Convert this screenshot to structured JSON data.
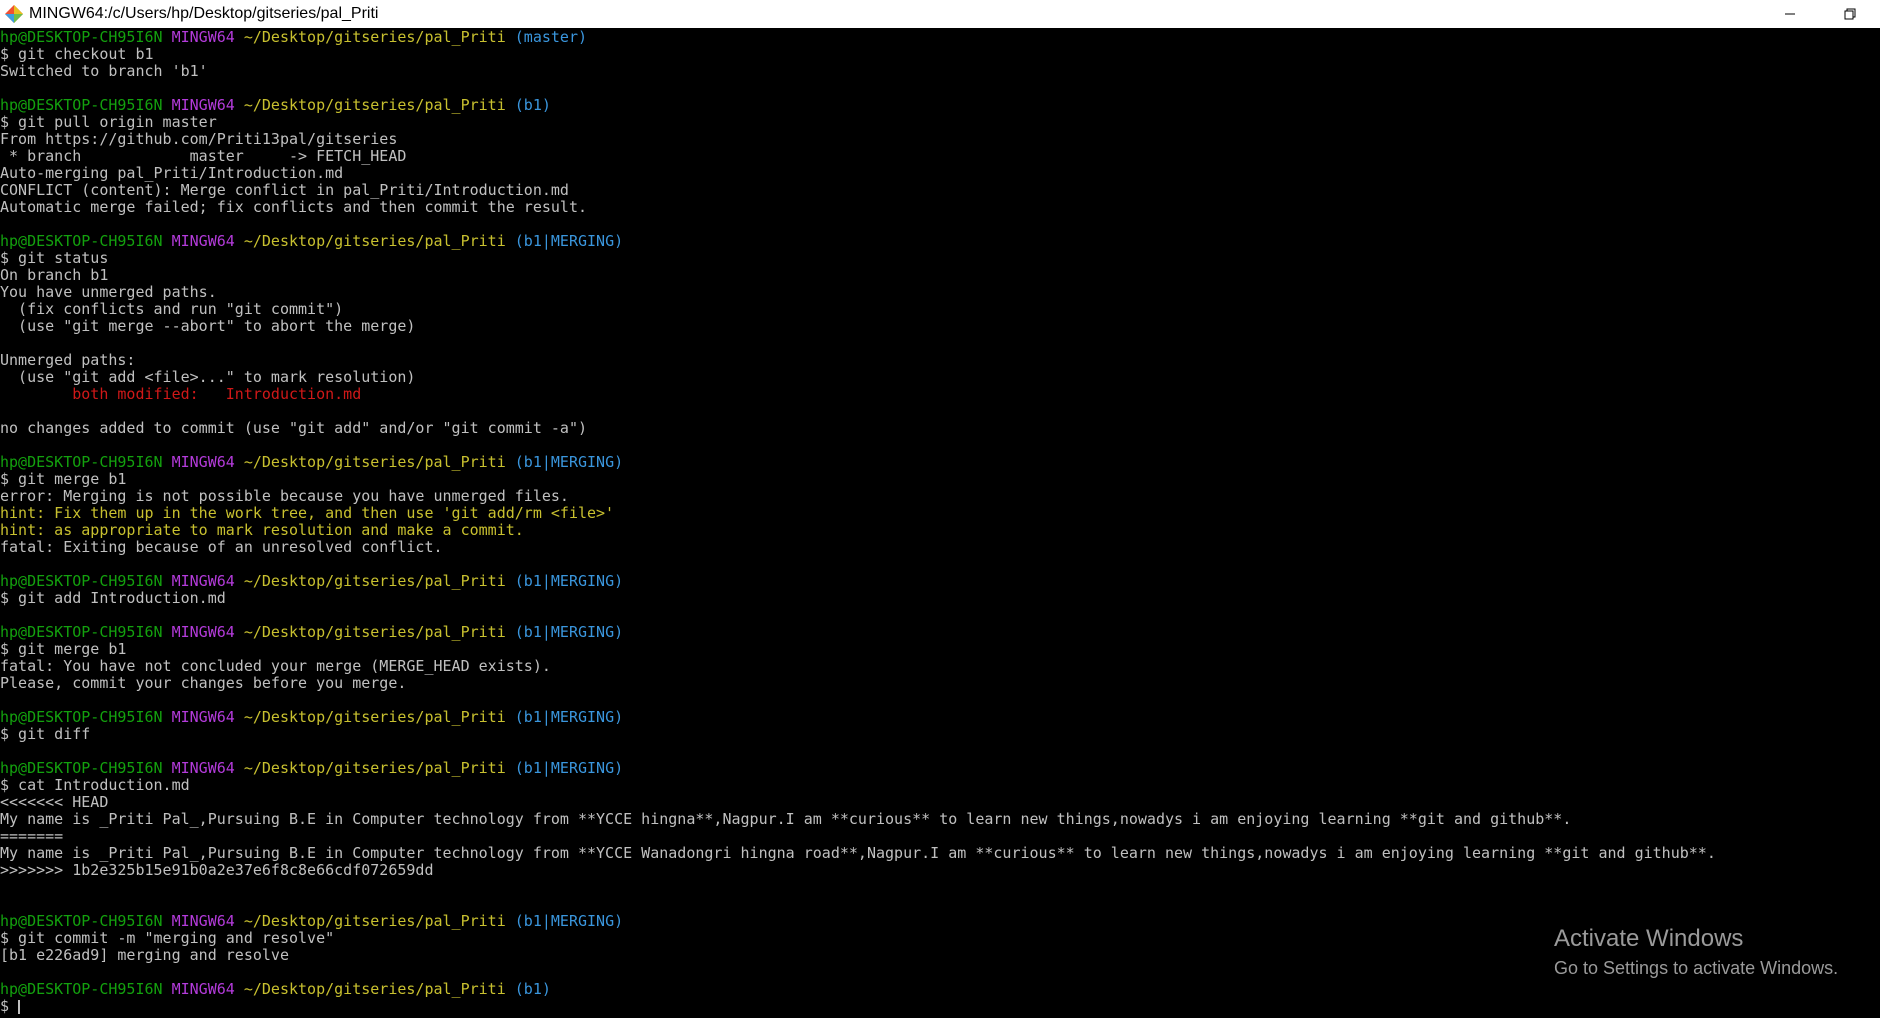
{
  "window": {
    "title": "MINGW64:/c/Users/hp/Desktop/gitseries/pal_Priti",
    "icons": [
      "git-bash-icon",
      "minimize-icon",
      "restore-icon"
    ]
  },
  "colors": {
    "background": "#000000",
    "text": "#c0c0c0",
    "user_host": "#13a10e",
    "mingw": "#b43bdb",
    "path": "#c8c02f",
    "branch": "#3a96dd",
    "error": "#d01818"
  },
  "terminal": {
    "lines": [
      {
        "type": "prompt",
        "user": "hp@DESKTOP-CH95I6N",
        "env": "MINGW64",
        "path": "~/Desktop/gitseries/pal_Priti",
        "branch": "(master)"
      },
      {
        "type": "cmd",
        "text": "$ git checkout b1"
      },
      {
        "type": "out",
        "text": "Switched to branch 'b1'"
      },
      {
        "type": "blank",
        "text": ""
      },
      {
        "type": "prompt",
        "user": "hp@DESKTOP-CH95I6N",
        "env": "MINGW64",
        "path": "~/Desktop/gitseries/pal_Priti",
        "branch": "(b1)"
      },
      {
        "type": "cmd",
        "text": "$ git pull origin master"
      },
      {
        "type": "out",
        "text": "From https://github.com/Priti13pal/gitseries"
      },
      {
        "type": "out",
        "text": " * branch            master     -> FETCH_HEAD"
      },
      {
        "type": "out",
        "text": "Auto-merging pal_Priti/Introduction.md"
      },
      {
        "type": "out",
        "text": "CONFLICT (content): Merge conflict in pal_Priti/Introduction.md"
      },
      {
        "type": "out",
        "text": "Automatic merge failed; fix conflicts and then commit the result."
      },
      {
        "type": "blank",
        "text": ""
      },
      {
        "type": "prompt",
        "user": "hp@DESKTOP-CH95I6N",
        "env": "MINGW64",
        "path": "~/Desktop/gitseries/pal_Priti",
        "branch": "(b1|MERGING)"
      },
      {
        "type": "cmd",
        "text": "$ git status"
      },
      {
        "type": "out",
        "text": "On branch b1"
      },
      {
        "type": "out",
        "text": "You have unmerged paths."
      },
      {
        "type": "out",
        "text": "  (fix conflicts and run \"git commit\")"
      },
      {
        "type": "out",
        "text": "  (use \"git merge --abort\" to abort the merge)"
      },
      {
        "type": "blank",
        "text": ""
      },
      {
        "type": "out",
        "text": "Unmerged paths:"
      },
      {
        "type": "out",
        "text": "  (use \"git add <file>...\" to mark resolution)"
      },
      {
        "type": "error",
        "text": "        both modified:   Introduction.md"
      },
      {
        "type": "blank",
        "text": ""
      },
      {
        "type": "out",
        "text": "no changes added to commit (use \"git add\" and/or \"git commit -a\")"
      },
      {
        "type": "blank",
        "text": ""
      },
      {
        "type": "prompt",
        "user": "hp@DESKTOP-CH95I6N",
        "env": "MINGW64",
        "path": "~/Desktop/gitseries/pal_Priti",
        "branch": "(b1|MERGING)"
      },
      {
        "type": "cmd",
        "text": "$ git merge b1"
      },
      {
        "type": "out",
        "text": "error: Merging is not possible because you have unmerged files."
      },
      {
        "type": "hint",
        "text": "hint: Fix them up in the work tree, and then use 'git add/rm <file>'"
      },
      {
        "type": "hint",
        "text": "hint: as appropriate to mark resolution and make a commit."
      },
      {
        "type": "out",
        "text": "fatal: Exiting because of an unresolved conflict."
      },
      {
        "type": "blank",
        "text": ""
      },
      {
        "type": "prompt",
        "user": "hp@DESKTOP-CH95I6N",
        "env": "MINGW64",
        "path": "~/Desktop/gitseries/pal_Priti",
        "branch": "(b1|MERGING)"
      },
      {
        "type": "cmd",
        "text": "$ git add Introduction.md"
      },
      {
        "type": "blank",
        "text": ""
      },
      {
        "type": "prompt",
        "user": "hp@DESKTOP-CH95I6N",
        "env": "MINGW64",
        "path": "~/Desktop/gitseries/pal_Priti",
        "branch": "(b1|MERGING)"
      },
      {
        "type": "cmd",
        "text": "$ git merge b1"
      },
      {
        "type": "out",
        "text": "fatal: You have not concluded your merge (MERGE_HEAD exists)."
      },
      {
        "type": "out",
        "text": "Please, commit your changes before you merge."
      },
      {
        "type": "blank",
        "text": ""
      },
      {
        "type": "prompt",
        "user": "hp@DESKTOP-CH95I6N",
        "env": "MINGW64",
        "path": "~/Desktop/gitseries/pal_Priti",
        "branch": "(b1|MERGING)"
      },
      {
        "type": "cmd",
        "text": "$ git diff"
      },
      {
        "type": "blank",
        "text": ""
      },
      {
        "type": "prompt",
        "user": "hp@DESKTOP-CH95I6N",
        "env": "MINGW64",
        "path": "~/Desktop/gitseries/pal_Priti",
        "branch": "(b1|MERGING)"
      },
      {
        "type": "cmd",
        "text": "$ cat Introduction.md"
      },
      {
        "type": "out",
        "text": "<<<<<<< HEAD"
      },
      {
        "type": "out",
        "text": "My name is _Priti Pal_,Pursuing B.E in Computer technology from **YCCE hingna**,Nagpur.I am **curious** to learn new things,nowadys i am enjoying learning **git and github**."
      },
      {
        "type": "out",
        "text": "======="
      },
      {
        "type": "out",
        "text": "My name is _Priti Pal_,Pursuing B.E in Computer technology from **YCCE Wanadongri hingna road**,Nagpur.I am **curious** to learn new things,nowadys i am enjoying learning **git and github**."
      },
      {
        "type": "out",
        "text": ">>>>>>> 1b2e325b15e91b0a2e37e6f8c8e66cdf072659dd"
      },
      {
        "type": "blank",
        "text": ""
      },
      {
        "type": "blank",
        "text": ""
      },
      {
        "type": "prompt",
        "user": "hp@DESKTOP-CH95I6N",
        "env": "MINGW64",
        "path": "~/Desktop/gitseries/pal_Priti",
        "branch": "(b1|MERGING)"
      },
      {
        "type": "cmd",
        "text": "$ git commit -m \"merging and resolve\""
      },
      {
        "type": "out",
        "text": "[b1 e226ad9] merging and resolve"
      },
      {
        "type": "blank",
        "text": ""
      },
      {
        "type": "prompt",
        "user": "hp@DESKTOP-CH95I6N",
        "env": "MINGW64",
        "path": "~/Desktop/gitseries/pal_Priti",
        "branch": "(b1)"
      },
      {
        "type": "input",
        "text": "$ "
      }
    ]
  },
  "watermark": {
    "title": "Activate Windows",
    "subtitle": "Go to Settings to activate Windows."
  }
}
